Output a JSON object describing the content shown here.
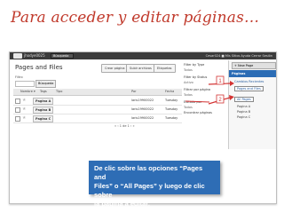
{
  "slide": {
    "title": "Para acceder y editar páginas…"
  },
  "topbar": {
    "site_name": "jhodye0025",
    "search_button": "Búsqueda",
    "links": "Cesar024 ■ Mis Sitios Ayuda Cerrar Sesión"
  },
  "main": {
    "title": "Pages and Files",
    "toolbar": {
      "new_page": "Crear página",
      "upload": "Subir archivos",
      "tags": "Etiquetas"
    },
    "filter_label": "Filtro",
    "filter_button": "Búsqueda",
    "columns": {
      "name": "Nombre ▾",
      "tags": "Tags",
      "type": "Tipo",
      "owner": "Por",
      "date": "Fecha"
    },
    "rows": [
      {
        "name": "Pagina A",
        "owner": "laris19900022",
        "date": "Tuesday"
      },
      {
        "name": "Pagina B",
        "owner": "laris19900022",
        "date": "Tuesday"
      },
      {
        "name": "Pagina C",
        "owner": "laris19900022",
        "date": "Tuesday"
      }
    ],
    "pager": "« ‹ 1 de 1 › »"
  },
  "filters": {
    "by_type": "Filter by Type",
    "type_value": "Todos",
    "by_status": "Filter by Status",
    "status_value": "Activo",
    "by_page": "Filtrar por página",
    "page_value": "Todas",
    "edited_label": "Editado por",
    "edited_value": "Todos",
    "edited_label2": "Sólo por",
    "find_pages": "Encontrar páginas"
  },
  "sidebar": {
    "new_page": "+ New Page",
    "header": "Páginas",
    "items": [
      "Cambios Recientes",
      "Pages and Files"
    ],
    "all_pages": "All Pages",
    "sub_items": [
      "Pagina A",
      "Pagina B",
      "Pagina C"
    ]
  },
  "annotations": {
    "arrow_color": "#d33333",
    "badges": [
      "1",
      "2"
    ]
  },
  "callout": {
    "line1": "De clic sobre las opciones “Pages and",
    "line2": "Files” o “All Pages” y luego de clic sobre",
    "line3": "la página a editar."
  },
  "colors": {
    "title": "#c0392b",
    "sidebar_header": "#2b6cb5",
    "callout_bg": "#2e6db5"
  }
}
